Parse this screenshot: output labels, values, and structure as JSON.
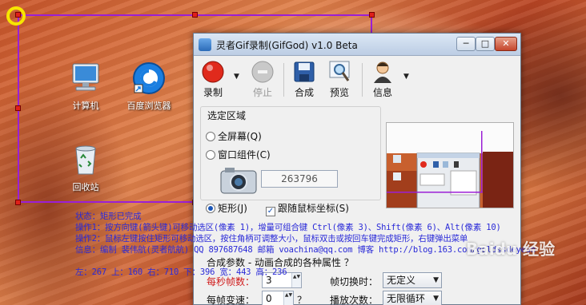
{
  "desktop": {
    "icons": [
      {
        "label": "计算机",
        "icon": "computer-icon"
      },
      {
        "label": "百度浏览器",
        "icon": "browser-icon"
      },
      {
        "label": "回收站",
        "icon": "recycle-bin-icon"
      }
    ]
  },
  "overlay_info": {
    "status": "状态：矩形已完成",
    "op1": "操作1：按方向键(箭头键)可移动选区(像素 1)，增量可组合键 Ctrl(像素 3)、Shift(像素 6)、Alt(像素 10)",
    "op2": "操作2：鼠标左键按住矩形可移动选区，按住角柄可调整大小，鼠标双击或按回车键完成矩形，右键弹出菜单",
    "credit": "信息：编制 裴伟航(灵者航航) QQ 897687648 邮箱 voachina@qq.com 博客 http://blog.163.com/goldssdeyeah",
    "coords": "左：267 上：160 右：710 下：396 宽：443 高：236"
  },
  "window": {
    "title": "灵者Gif录制(GifGod) v1.0 Beta",
    "caption_buttons": {
      "minimize": "─",
      "maximize": "□",
      "close": "✕"
    },
    "toolbar": {
      "record": "录制",
      "stop": "停止",
      "compose": "合成",
      "preview": "预览",
      "info": "信息",
      "dropdown_arrow": "▼"
    },
    "select_area": {
      "title": "选定区域",
      "fullscreen": "全屏幕(Q)",
      "window_component": "窗口组件(C)",
      "handle_value": "263796",
      "rectangle": "矩形(J)",
      "follow_mouse": "跟随鼠标坐标(S)",
      "check_mark": "✓"
    },
    "compose_params": {
      "title": "合成参数 - 动画合成的各种属性  ？",
      "fps_label": "每秒帧数：",
      "fps_value": "3",
      "frame_speed_label": "每帧变速：",
      "frame_speed_value": "0",
      "frame_speed_help": "？",
      "frame_switch_label": "帧切换时：",
      "frame_switch_value": "无定义",
      "play_count_label": "播放次数：",
      "play_count_value": "无限循环",
      "spin_arrows": "▲▼"
    }
  },
  "watermark": "Baidu 经验",
  "colors": {
    "selection": "#9b1fd6",
    "handle": "#e0201a",
    "highlight_ring": "#f7e600",
    "info_text": "#2a2ad8",
    "param_label_red": "#d01c1c"
  }
}
